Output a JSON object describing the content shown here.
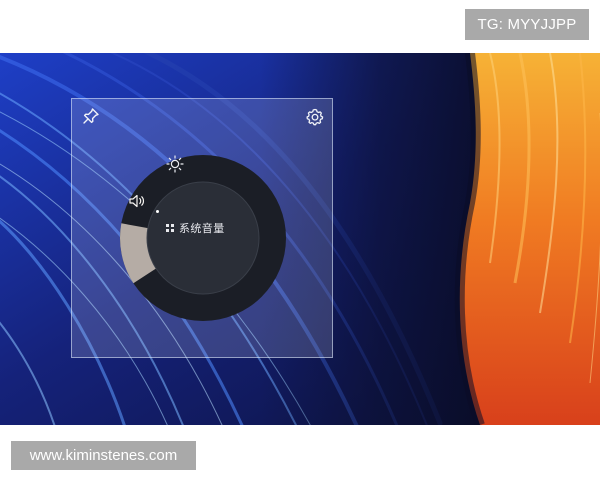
{
  "overlay": {
    "telegram_handle": "TG: MYYJJPP",
    "website": "www.kiminstenes.com"
  },
  "widget": {
    "device_label": "系统音量",
    "icons": {
      "pin": "pin-icon",
      "settings": "gear-icon",
      "brightness": "sun-icon",
      "volume": "speaker-icon",
      "device": "grid-icon"
    },
    "volume_level": 0.12
  },
  "colors": {
    "dial_outer": "#1b1e26",
    "dial_inner": "#2a2e37",
    "volume_segment": "#b5aca5",
    "panel_border": "#dfe8ff",
    "wallpaper_blue": "#1b3aa8",
    "wallpaper_orange": "#f08a2a"
  }
}
